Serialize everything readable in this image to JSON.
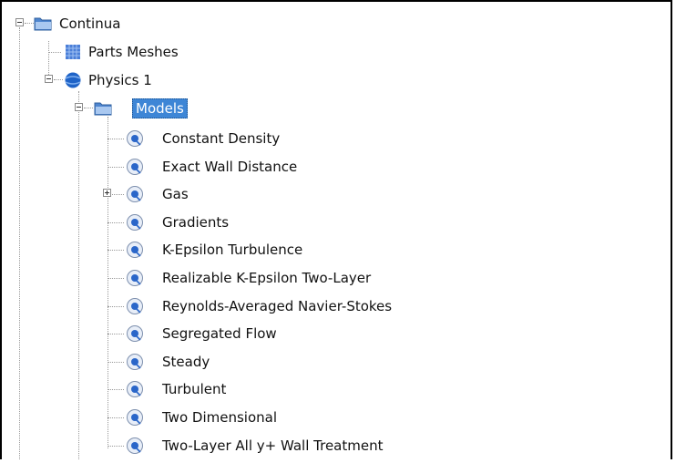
{
  "tree": {
    "continua": {
      "label": "Continua",
      "icon": "folder-icon"
    },
    "parts_meshes": {
      "label": "Parts Meshes",
      "icon": "mesh-grid-icon"
    },
    "physics1": {
      "label": "Physics 1",
      "icon": "sphere-icon"
    },
    "models": {
      "label": "Models",
      "icon": "folder-icon",
      "selected": true
    },
    "model_items": [
      {
        "label": "Constant Density",
        "icon": "model-node-icon"
      },
      {
        "label": "Exact Wall Distance",
        "icon": "model-node-icon"
      },
      {
        "label": "Gas",
        "icon": "model-node-icon",
        "expandable": true
      },
      {
        "label": "Gradients",
        "icon": "model-node-icon"
      },
      {
        "label": "K-Epsilon Turbulence",
        "icon": "model-node-icon"
      },
      {
        "label": "Realizable K-Epsilon Two-Layer",
        "icon": "model-node-icon"
      },
      {
        "label": "Reynolds-Averaged Navier-Stokes",
        "icon": "model-node-icon"
      },
      {
        "label": "Segregated Flow",
        "icon": "model-node-icon"
      },
      {
        "label": "Steady",
        "icon": "model-node-icon"
      },
      {
        "label": "Turbulent",
        "icon": "model-node-icon"
      },
      {
        "label": "Two Dimensional",
        "icon": "model-node-icon"
      },
      {
        "label": "Two-Layer All y+ Wall Treatment",
        "icon": "model-node-icon"
      }
    ]
  },
  "colors": {
    "selection": "#3e86d6",
    "folder": "#5a8fd6",
    "sphere": "#1f63c7"
  }
}
